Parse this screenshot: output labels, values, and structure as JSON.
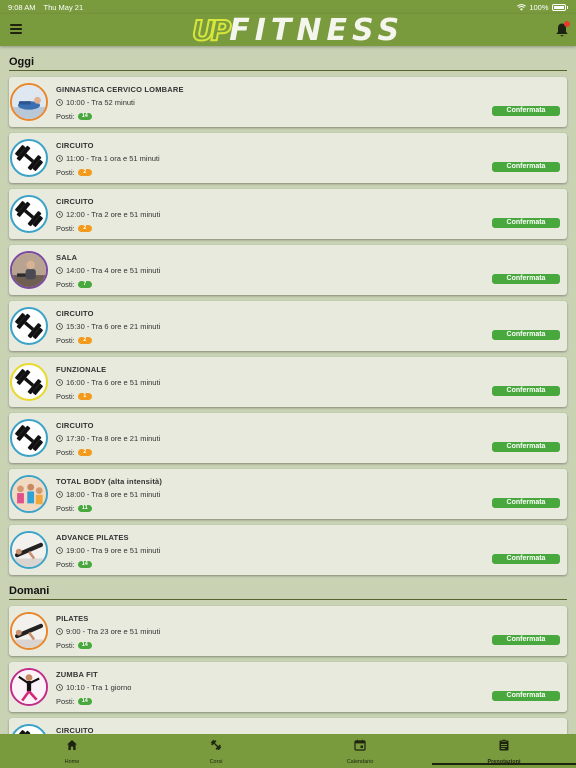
{
  "status_bar": {
    "time": "9:08 AM",
    "date": "Thu May 21",
    "battery": "100%"
  },
  "header": {
    "logo_up": "UP",
    "logo_word": "FITNESS"
  },
  "labels": {
    "posti": "Posti:"
  },
  "colors": {
    "accent": "#7a9a3e",
    "confirmed": "#48a83e",
    "badge_green": "#48a83e",
    "badge_orange": "#f19a1c"
  },
  "sections": [
    {
      "title": "Oggi",
      "items": [
        {
          "title": "GINNASTICA CERVICO LOMBARE",
          "time": "10:00 - Tra 52 minuti",
          "posti": "14",
          "posti_color": "green",
          "status": "Confermata",
          "icon": "stretching-photo",
          "ring": "#e8862a"
        },
        {
          "title": "CIRCUITO",
          "time": "11:00 - Tra 1 ora e 51 minuti",
          "posti": "2",
          "posti_color": "orange",
          "status": "Confermata",
          "icon": "dumbbell-icon",
          "ring": "#3aa3c8"
        },
        {
          "title": "CIRCUITO",
          "time": "12:00 - Tra 2 ore e 51 minuti",
          "posti": "2",
          "posti_color": "orange",
          "status": "Confermata",
          "icon": "dumbbell-icon",
          "ring": "#3aa3c8"
        },
        {
          "title": "SALA",
          "time": "14:00 - Tra 4 ore e 51 minuti",
          "posti": "7",
          "posti_color": "green",
          "status": "Confermata",
          "icon": "gym-photo",
          "ring": "#7a4aa0"
        },
        {
          "title": "CIRCUITO",
          "time": "15:30 - Tra 6 ore e 21 minuti",
          "posti": "2",
          "posti_color": "orange",
          "status": "Confermata",
          "icon": "dumbbell-icon",
          "ring": "#3aa3c8"
        },
        {
          "title": "FUNZIONALE",
          "time": "16:00 - Tra 6 ore e 51 minuti",
          "posti": "1",
          "posti_color": "orange",
          "status": "Confermata",
          "icon": "dumbbell-icon",
          "ring": "#e8d92a"
        },
        {
          "title": "CIRCUITO",
          "time": "17:30 - Tra 8 ore e 21 minuti",
          "posti": "2",
          "posti_color": "orange",
          "status": "Confermata",
          "icon": "dumbbell-icon",
          "ring": "#3aa3c8"
        },
        {
          "title": "TOTAL BODY (alta intensità)",
          "time": "18:00 - Tra 8 ore e 51 minuti",
          "posti": "11",
          "posti_color": "green",
          "status": "Confermata",
          "icon": "group-class-photo",
          "ring": "#3aa3c8"
        },
        {
          "title": "ADVANCE PILATES",
          "time": "19:00 - Tra 9 ore e 51 minuti",
          "posti": "14",
          "posti_color": "green",
          "status": "Confermata",
          "icon": "pilates-photo",
          "ring": "#3aa3c8"
        }
      ]
    },
    {
      "title": "Domani",
      "items": [
        {
          "title": "PILATES",
          "time": "9:00 - Tra 23 ore e 51 minuti",
          "posti": "14",
          "posti_color": "green",
          "status": "Confermata",
          "icon": "pilates-photo",
          "ring": "#e8862a"
        },
        {
          "title": "ZUMBA FIT",
          "time": "10:10 - Tra 1 giorno",
          "posti": "14",
          "posti_color": "green",
          "status": "Confermata",
          "icon": "zumba-photo",
          "ring": "#c02a8a"
        },
        {
          "title": "CIRCUITO",
          "time": "",
          "posti": "",
          "posti_color": "green",
          "status": "",
          "icon": "dumbbell-icon",
          "ring": "#3aa3c8"
        }
      ]
    }
  ],
  "bottom_nav": [
    {
      "label": "Home",
      "icon": "home-icon",
      "active": false
    },
    {
      "label": "Corsi",
      "icon": "dumbbell-nav-icon",
      "active": false
    },
    {
      "label": "Calendario",
      "icon": "calendar-icon",
      "active": false
    },
    {
      "label": "Prenotazioni",
      "icon": "clipboard-icon",
      "active": true
    }
  ]
}
